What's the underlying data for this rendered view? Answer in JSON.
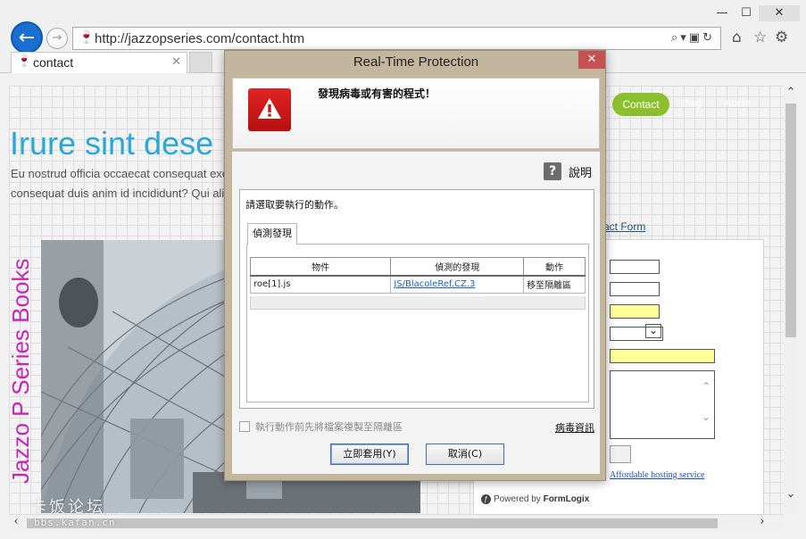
{
  "browser": {
    "url": "http://jazzopseries.com/contact.htm",
    "tab_title": "contact",
    "window_buttons": {
      "minimize": "—",
      "maximize": "☐",
      "close": "✕"
    },
    "toolbar_icons": [
      "home-icon",
      "star-icon",
      "gear-icon"
    ]
  },
  "page": {
    "nav": {
      "contact": "Contact",
      "blog": "Blog",
      "about": "About"
    },
    "heading": "Irure sint dese",
    "intro_line1": "Eu nostrud officia occaecat consequat exe                                                          r ut cillum",
    "intro_line2": "consequat duis anim id incididunt? Qui ali",
    "vertical_title": "Jazzo P Series Books",
    "form_title": "act Form",
    "hosting_link": "Affordable hosting service",
    "powered_by_prefix": "Powered by",
    "powered_by_brand": "FormLogix"
  },
  "watermark": {
    "main": "卡饭论坛",
    "sub": "bbs.kafan.cn"
  },
  "dialog": {
    "title": "Real-Time Protection",
    "heading": "發現病毒或有害的程式！",
    "help_label": "說明",
    "action_prompt": "請選取要執行的動作。",
    "tab_label": "偵測發現",
    "table": {
      "columns": [
        "物件",
        "偵測的發現",
        "動作"
      ],
      "rows": [
        {
          "object": "roe[1].js",
          "finding": "JS/BlacoleRef.CZ.3",
          "action": "移至隔離區"
        }
      ]
    },
    "checkbox_label": "執行動作前先將檔案複製至隔離區",
    "checkbox_checked": false,
    "virus_info": "病毒資訊",
    "apply_button": "立即套用(Y)",
    "cancel_button": "取消(C)"
  },
  "colors": {
    "heading_blue": "#2aa9d8",
    "vertical_title_magenta": "#c227b8",
    "nav_green": "#8bbf2b",
    "warning_red": "#c41a1a",
    "dialog_frame": "#c3b59e"
  }
}
